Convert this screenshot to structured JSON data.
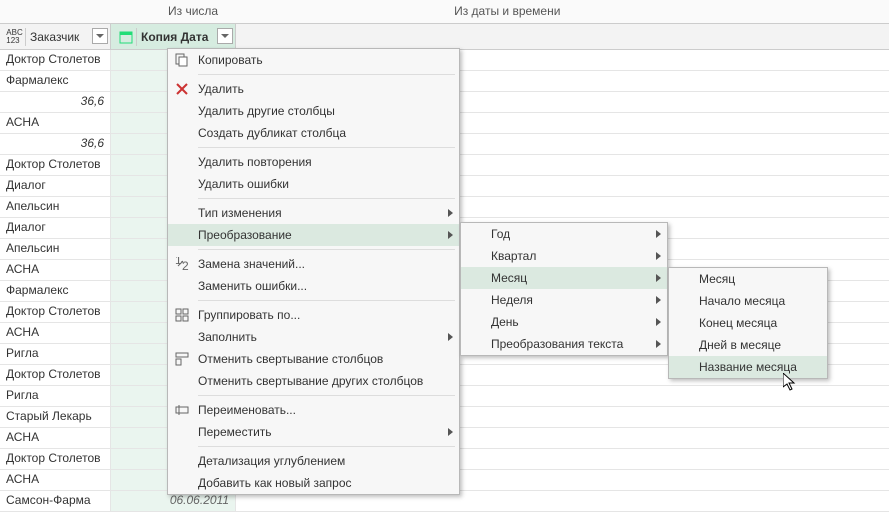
{
  "ribbon": {
    "tab1": "Из числа",
    "tab2": "Из даты и времени"
  },
  "headers": {
    "col1": "Заказчик",
    "col2": "Копия Дата",
    "type_icon1": "ABC 123",
    "type_icon2": "cal"
  },
  "rows": [
    {
      "c1": "Доктор Столетов",
      "c2": ""
    },
    {
      "c1": "Фармалекс",
      "c2": ""
    },
    {
      "c1": "36,6",
      "c2": "",
      "numeric": true
    },
    {
      "c1": "АСНА",
      "c2": ""
    },
    {
      "c1": "36,6",
      "c2": "",
      "numeric": true
    },
    {
      "c1": "Доктор Столетов",
      "c2": ""
    },
    {
      "c1": "Диалог",
      "c2": ""
    },
    {
      "c1": "Апельсин",
      "c2": ""
    },
    {
      "c1": "Диалог",
      "c2": ""
    },
    {
      "c1": "Апельсин",
      "c2": ""
    },
    {
      "c1": "АСНА",
      "c2": ""
    },
    {
      "c1": "Фармалекс",
      "c2": ""
    },
    {
      "c1": "Доктор Столетов",
      "c2": ""
    },
    {
      "c1": "АСНА",
      "c2": ""
    },
    {
      "c1": "Ригла",
      "c2": ""
    },
    {
      "c1": "Доктор Столетов",
      "c2": ""
    },
    {
      "c1": "Ригла",
      "c2": ""
    },
    {
      "c1": "Старый Лекарь",
      "c2": ""
    },
    {
      "c1": "АСНА",
      "c2": ""
    },
    {
      "c1": "Доктор Столетов",
      "c2": ""
    },
    {
      "c1": "АСНА",
      "c2": ""
    },
    {
      "c1": "Самсон-Фарма",
      "c2": "06.06.2011"
    }
  ],
  "menu_main": [
    {
      "label": "Копировать",
      "icon": "copy"
    },
    {
      "sep": true
    },
    {
      "label": "Удалить",
      "icon": "delete"
    },
    {
      "label": "Удалить другие столбцы"
    },
    {
      "label": "Создать дубликат столбца"
    },
    {
      "sep": true
    },
    {
      "label": "Удалить повторения"
    },
    {
      "label": "Удалить ошибки"
    },
    {
      "sep": true
    },
    {
      "label": "Тип изменения",
      "sub": true
    },
    {
      "label": "Преобразование",
      "sub": true,
      "hovered": true
    },
    {
      "sep": true
    },
    {
      "label": "Замена значений...",
      "icon": "replace"
    },
    {
      "label": "Заменить ошибки..."
    },
    {
      "sep": true
    },
    {
      "label": "Группировать по...",
      "icon": "group"
    },
    {
      "label": "Заполнить",
      "sub": true
    },
    {
      "label": "Отменить свертывание столбцов",
      "icon": "unpivot"
    },
    {
      "label": "Отменить свертывание других столбцов"
    },
    {
      "sep": true
    },
    {
      "label": "Переименовать...",
      "icon": "rename"
    },
    {
      "label": "Переместить",
      "sub": true
    },
    {
      "sep": true
    },
    {
      "label": "Детализация углублением"
    },
    {
      "label": "Добавить как новый запрос"
    }
  ],
  "menu_sub1": [
    {
      "label": "Год",
      "sub": true
    },
    {
      "label": "Квартал",
      "sub": true
    },
    {
      "label": "Месяц",
      "sub": true,
      "hovered": true
    },
    {
      "label": "Неделя",
      "sub": true
    },
    {
      "label": "День",
      "sub": true
    },
    {
      "label": "Преобразования текста",
      "sub": true
    }
  ],
  "menu_sub2": [
    {
      "label": "Месяц"
    },
    {
      "label": "Начало месяца"
    },
    {
      "label": "Конец месяца"
    },
    {
      "label": "Дней в месяце"
    },
    {
      "label": "Название месяца",
      "hovered": true
    }
  ]
}
